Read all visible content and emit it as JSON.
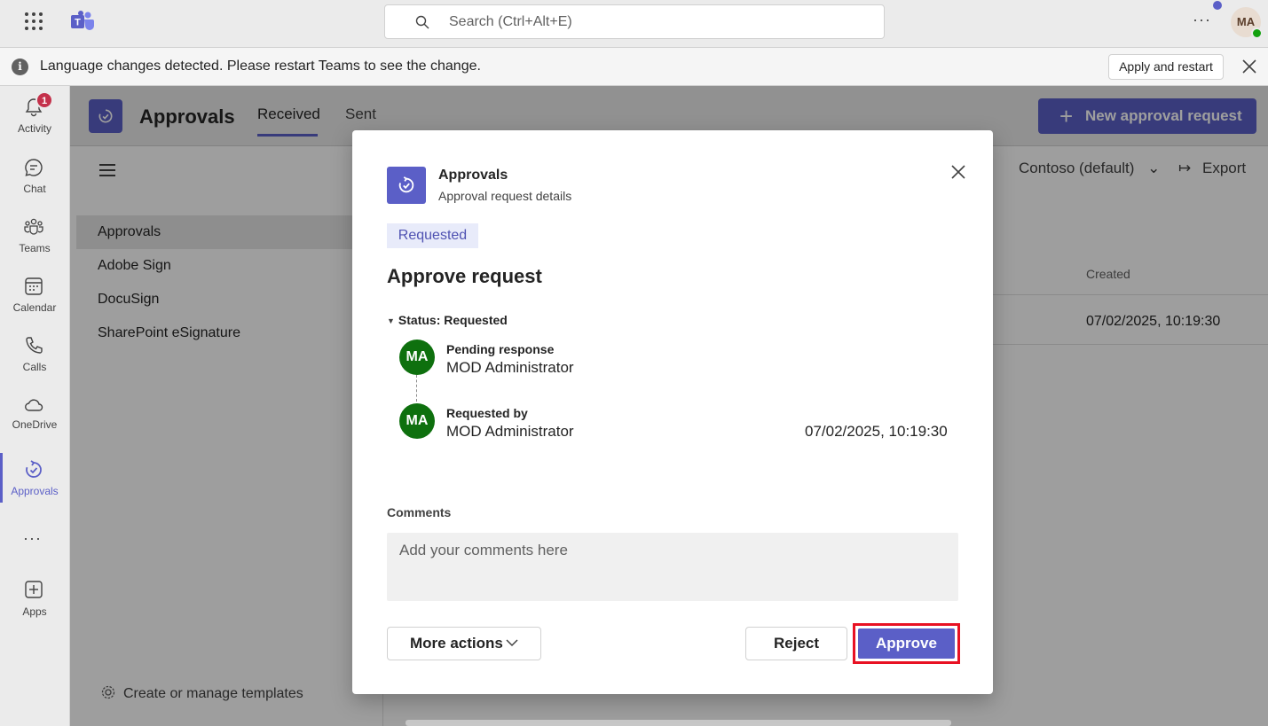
{
  "topbar": {
    "search_placeholder": "Search (Ctrl+Alt+E)",
    "more_label": "···",
    "user_initials": "MA"
  },
  "banner": {
    "message": "Language changes detected. Please restart Teams to see the change.",
    "apply_label": "Apply and restart"
  },
  "rail": {
    "items": [
      {
        "label": "Activity",
        "icon": "bell-icon",
        "badge": "1"
      },
      {
        "label": "Chat",
        "icon": "chat-icon"
      },
      {
        "label": "Teams",
        "icon": "teams-icon"
      },
      {
        "label": "Calendar",
        "icon": "calendar-icon"
      },
      {
        "label": "Calls",
        "icon": "phone-icon"
      },
      {
        "label": "OneDrive",
        "icon": "cloud-icon"
      },
      {
        "label": "Approvals",
        "icon": "approvals-icon",
        "active": true
      },
      {
        "label": "Apps",
        "icon": "add-app-icon"
      }
    ],
    "more_label": "···"
  },
  "app": {
    "title": "Approvals",
    "tabs": [
      {
        "label": "Received",
        "active": true
      },
      {
        "label": "Sent"
      }
    ],
    "new_button": "New approval request",
    "org_filter": "Contoso (default)",
    "export_label": "Export",
    "side_items": [
      "Approvals",
      "Adobe Sign",
      "DocuSign",
      "SharePoint eSignature"
    ],
    "templates_label": "Create or manage templates",
    "column_created": "Created",
    "row_created": "07/02/2025, 10:19:30"
  },
  "dialog": {
    "app_name": "Approvals",
    "subtitle": "Approval request details",
    "status_chip": "Requested",
    "title": "Approve request",
    "status_heading": "Status: Requested",
    "people": [
      {
        "initials": "MA",
        "label": "Pending response",
        "name": "MOD Administrator"
      },
      {
        "initials": "MA",
        "label": "Requested by",
        "name": "MOD Administrator",
        "date": "07/02/2025, 10:19:30"
      }
    ],
    "comments_label": "Comments",
    "comments_placeholder": "Add your comments here",
    "more_actions_label": "More actions",
    "reject_label": "Reject",
    "approve_label": "Approve"
  },
  "colors": {
    "brand": "#5b5fc7",
    "avatar_green": "#0e700e",
    "highlight": "#e81123",
    "badge_red": "#c4314b"
  }
}
